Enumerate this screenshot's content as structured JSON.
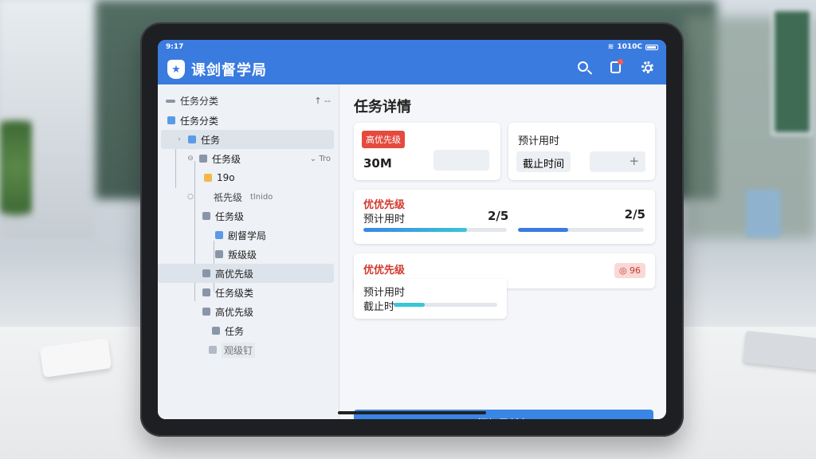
{
  "status": {
    "time": "9:17",
    "right": "1010C"
  },
  "app": {
    "title": "课剑督学局",
    "logo_glyph": "★"
  },
  "icons": {
    "search": "search-icon",
    "notifications": "bell-icon",
    "settings": "gear-icon",
    "accent": "#3a7be0",
    "alert_dot": "#ff5a4e"
  },
  "sidebar": {
    "header": {
      "label": "任务分类",
      "sort": "↑ --"
    },
    "items": [
      {
        "label": "任务分类",
        "meta": ""
      },
      {
        "label": "任务",
        "meta": ""
      },
      {
        "label": "任务级",
        "meta": "⌄  Tro"
      },
      {
        "label": "19o",
        "meta": ""
      },
      {
        "label": "祇先级",
        "meta": "tlnido"
      },
      {
        "label": "任务级",
        "meta": ""
      },
      {
        "label": "剧督学局",
        "meta": ""
      },
      {
        "label": "叛级级",
        "meta": ""
      },
      {
        "label": "高优先级",
        "meta": ""
      },
      {
        "label": "任务级类",
        "meta": ""
      },
      {
        "label": "高优先级",
        "meta": ""
      },
      {
        "label": "任务",
        "meta": ""
      },
      {
        "label": "观级钉",
        "meta": ""
      }
    ]
  },
  "main": {
    "title": "任务详情",
    "card1": {
      "tag": "高优先级",
      "value": "30M"
    },
    "card2": {
      "label": "预计用时",
      "button": "截止时间",
      "add": "+"
    },
    "card3": {
      "priority": "优优先级",
      "label": "预计用时",
      "count_left": "2/5",
      "count_right": "2/5",
      "progress_left": 0.72,
      "progress_right": 0.4
    },
    "card4": {
      "priority": "优优先级",
      "label1": "预计用时",
      "label2": "截止时",
      "badge": "◎ 96",
      "progress": 0.3
    },
    "add_subtask": "添加子任务"
  }
}
